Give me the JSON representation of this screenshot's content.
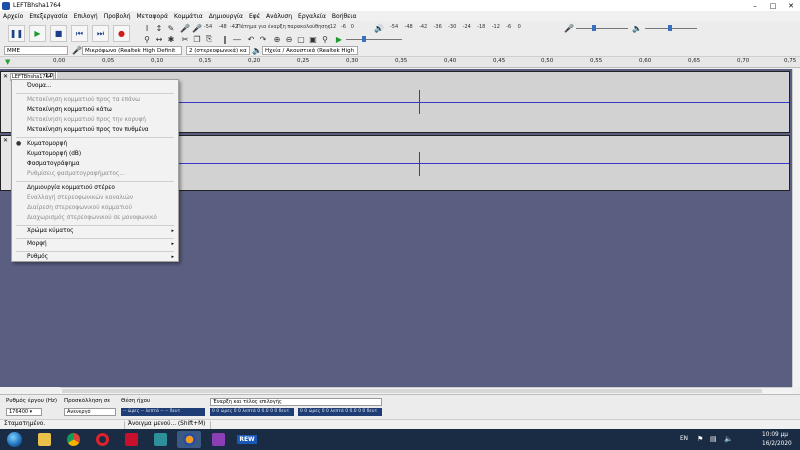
{
  "window": {
    "title": "LEFTBhsha1764"
  },
  "menubar": [
    "Αρχείο",
    "Επεξεργασία",
    "Επιλογή",
    "Προβολή",
    "Μεταφορά",
    "Κομμάτια",
    "Δημιουργία",
    "Εφέ",
    "Ανάλυση",
    "Εργαλεία",
    "Βοήθεια"
  ],
  "toolbar": {
    "transport": [
      "pause-icon",
      "play-icon",
      "stop-icon",
      "skip-start-icon",
      "skip-end-icon",
      "record-icon"
    ],
    "meter_hint": "Πάτημα για έναρξη παρακολούθησης",
    "rec_meter_scale": [
      "-54",
      "-48",
      "-42",
      "-18",
      "-12",
      "-6",
      "0"
    ],
    "play_meter_scale": [
      "-54",
      "-48",
      "-42",
      "-36",
      "-30",
      "-24",
      "-18",
      "-12",
      "-6",
      "0"
    ],
    "host": "MME",
    "rec_device": "Μικρόφωνο (Realtek High Definit",
    "channels": "2 (στερεοφωνικά) κα",
    "play_device": "Ηχεία / Ακουστικά (Realtek High"
  },
  "timeline": {
    "ticks": [
      "0,00",
      "0,05",
      "0,10",
      "0,15",
      "0,20",
      "0,25",
      "0,30",
      "0,35",
      "0,40",
      "0,45",
      "0,50",
      "0,55",
      "0,60",
      "0,65",
      "0,70",
      "0,75"
    ]
  },
  "tracks": [
    {
      "name": "LEFTBhsha1764",
      "dropdown": "▾",
      "value": "1,0"
    },
    {
      "name": "",
      "dropdown": "",
      "value": ""
    }
  ],
  "context_menu": {
    "items": [
      {
        "label": "Όνομα...",
        "enabled": true
      },
      {
        "label": "Μετακίνηση κομματιού προς τα επάνω",
        "enabled": false
      },
      {
        "label": "Μετακίνηση κομματιού κάτω",
        "enabled": true
      },
      {
        "label": "Μετακίνηση κομματιού προς την κορυφή",
        "enabled": false
      },
      {
        "label": "Μετακίνηση κομματιού προς τον πυθμένα",
        "enabled": true
      },
      {
        "label": "Κυματομορφή",
        "enabled": true,
        "checked": true
      },
      {
        "label": "Κυματομορφή (dB)",
        "enabled": true
      },
      {
        "label": "Φασματογράφημα",
        "enabled": true
      },
      {
        "label": "Ρυθμίσεις φασματογραφήματος...",
        "enabled": false
      },
      {
        "label": "Δημιουργία κομματιού στέρεο",
        "enabled": true
      },
      {
        "label": "Εναλλαγή στερεοφωνικών καναλιών",
        "enabled": false
      },
      {
        "label": "Διαίρεση στερεοφωνικού κομματιού",
        "enabled": false
      },
      {
        "label": "Διαχωρισμός στερεοφωνικού σε μονοφωνικό",
        "enabled": false
      },
      {
        "label": "Χρώμα κύματος",
        "enabled": true,
        "submenu": true
      },
      {
        "label": "Μορφή",
        "enabled": true,
        "submenu": true
      },
      {
        "label": "Ρυθμός",
        "enabled": true,
        "submenu": true
      }
    ]
  },
  "selection_bar": {
    "rate_label": "Ρυθμός έργου (Hz)",
    "rate_value": "176400",
    "snap_label": "Προσκόλληση σε",
    "snap_value": "Ανενεργό",
    "position_label": "Θέση ήχου",
    "position_value": "-- ώρες -- λεπτά -- -- δευτ",
    "selection_mode": "Έναρξη και τέλος επιλογής",
    "start_value": "0 0 ώρες 0 0 λεπτά 0 0.0 0 0 δευτ",
    "end_value": "0 0 ώρες 0 0 λεπτά 0 0.0 0 0 δευτ"
  },
  "status": {
    "left": "Σταματημένο.",
    "hint": "Άνοιγμα μενού... (Shift+M)"
  },
  "taskbar": {
    "apps": [
      "explorer-icon",
      "chrome-icon",
      "opera-icon",
      "app-red-icon",
      "app-teal-icon",
      "audacity-icon",
      "app-purple-icon",
      "app-rew-icon"
    ],
    "rew_label": "REW",
    "lang": "EN",
    "time": "10:09 μμ",
    "date": "16/2/2020"
  }
}
